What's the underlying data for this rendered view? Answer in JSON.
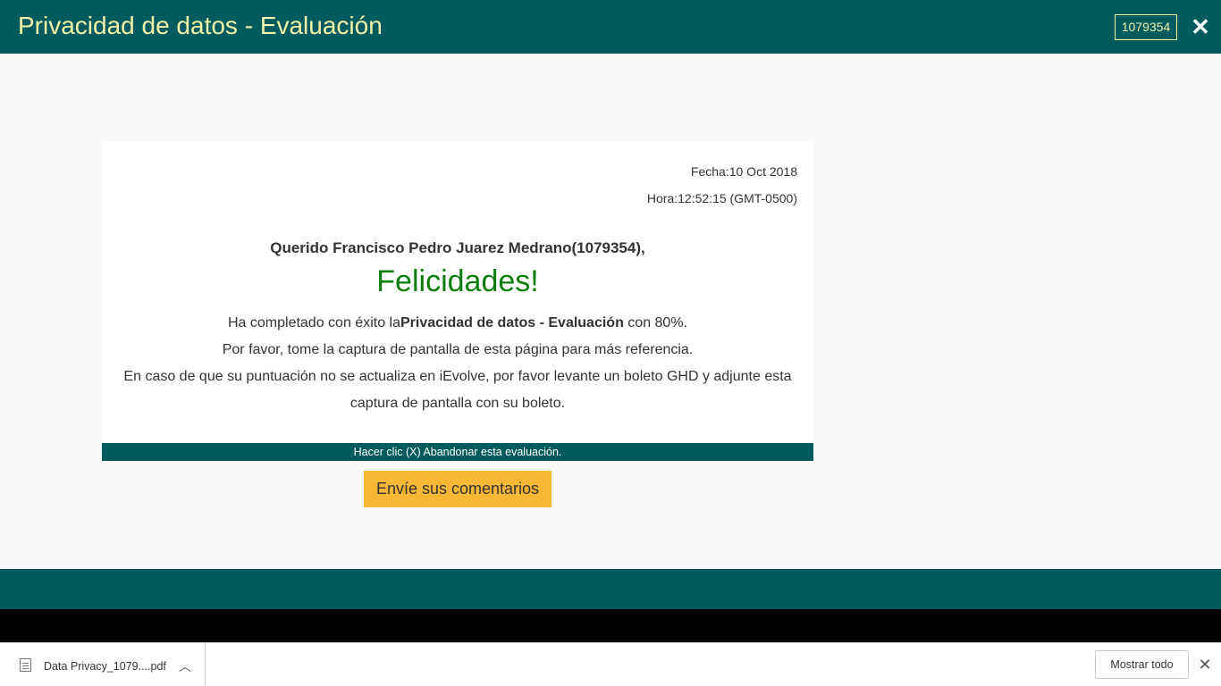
{
  "header": {
    "title": "Privacidad de datos - Evaluación",
    "id_badge": "1079354",
    "close_icon": "close-icon"
  },
  "card": {
    "date": "Fecha:10 Oct 2018",
    "time": "Hora:12:52:15 (GMT-0500)",
    "greeting": "Querido Francisco Pedro Juarez Medrano(1079354),",
    "congrats": "Felicidades!",
    "line1_prefix": "Ha completado con éxito la",
    "line1_bold": "Privacidad de datos - Evaluación",
    "line1_suffix": " con 80%.",
    "line2": "Por favor, tome la captura de pantalla de esta página para más referencia.",
    "line3": "En caso de que su puntuación no se actualiza en iEvolve, por favor levante un boleto GHD y adjunte esta captura de pantalla con su boleto."
  },
  "abandon_bar": "Hacer clic (X) Abandonar esta evaluación.",
  "feedback_button": "Envíe sus comentarios",
  "download_bar": {
    "file_name": "Data Privacy_1079....pdf",
    "show_all": "Mostrar todo"
  },
  "colors": {
    "brand": "#005a5e",
    "title_text": "#f2f2a8",
    "congrats": "#0a7d0a",
    "button": "#f8b734"
  }
}
